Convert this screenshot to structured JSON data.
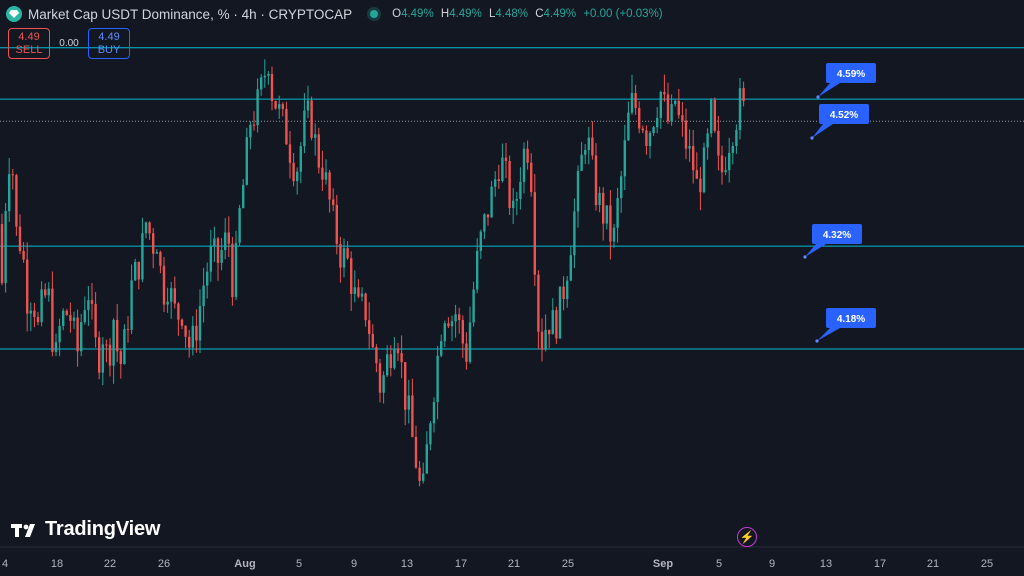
{
  "header": {
    "symbol_title": "Market Cap USDT Dominance, % · 4h · CRYPTOCAP",
    "ohlc": [
      {
        "k": "O",
        "v": "4.49%"
      },
      {
        "k": "H",
        "v": "4.49%"
      },
      {
        "k": "L",
        "v": "4.48%"
      },
      {
        "k": "C",
        "v": "4.49%"
      },
      {
        "k": "",
        "v": "+0.00 (+0.03%)"
      }
    ]
  },
  "trade": {
    "sell_price": "4.49",
    "sell_label": "SELL",
    "spread": "0.00",
    "buy_price": "4.49",
    "buy_label": "BUY"
  },
  "branding": {
    "name": "TradingView"
  },
  "colors": {
    "background": "#131722",
    "up": "#26a69a",
    "down": "#ef5350",
    "level_line": "#00bcd4",
    "label_bg": "#2962ff",
    "axis_text": "#b2b5be"
  },
  "chart_data": {
    "type": "candlestick",
    "title": "Market Cap USDT Dominance, % · 4h · CRYPTOCAP",
    "unit": "%",
    "ylim": [
      3.92,
      4.655
    ],
    "x_ticks": [
      "4",
      "18",
      "22",
      "26",
      "Aug",
      "5",
      "9",
      "13",
      "17",
      "21",
      "25",
      "Sep",
      "5",
      "9",
      "13",
      "17",
      "21",
      "25"
    ],
    "bold_ticks": [
      "Aug",
      "Sep"
    ],
    "levels": [
      {
        "label": "4.59%",
        "value": 4.59
      },
      {
        "label": "4.52%",
        "value": 4.52
      },
      {
        "label": "4.32%",
        "value": 4.32
      },
      {
        "label": "4.18%",
        "value": 4.18
      }
    ],
    "last_price": 4.49,
    "price_path": [
      [
        0,
        4.35
      ],
      [
        2,
        4.27
      ],
      [
        5,
        4.37
      ],
      [
        9,
        4.44
      ],
      [
        13,
        4.42
      ],
      [
        16,
        4.34
      ],
      [
        22,
        4.32
      ],
      [
        28,
        4.24
      ],
      [
        33,
        4.26
      ],
      [
        37,
        4.2
      ],
      [
        42,
        4.24
      ],
      [
        48,
        4.26
      ],
      [
        55,
        4.16
      ],
      [
        61,
        4.22
      ],
      [
        66,
        4.23
      ],
      [
        72,
        4.22
      ],
      [
        77,
        4.17
      ],
      [
        83,
        4.24
      ],
      [
        89,
        4.26
      ],
      [
        94,
        4.19
      ],
      [
        99,
        4.17
      ],
      [
        104,
        4.21
      ],
      [
        108,
        4.15
      ],
      [
        113,
        4.23
      ],
      [
        117,
        4.18
      ],
      [
        121,
        4.16
      ],
      [
        126,
        4.2
      ],
      [
        132,
        4.27
      ],
      [
        140,
        4.3
      ],
      [
        148,
        4.37
      ],
      [
        151,
        4.31
      ],
      [
        156,
        4.34
      ],
      [
        160,
        4.29
      ],
      [
        164,
        4.26
      ],
      [
        168,
        4.27
      ],
      [
        173,
        4.24
      ],
      [
        177,
        4.22
      ],
      [
        181,
        4.24
      ],
      [
        185,
        4.21
      ],
      [
        190,
        4.18
      ],
      [
        195,
        4.2
      ],
      [
        199,
        4.23
      ],
      [
        205,
        4.28
      ],
      [
        212,
        4.31
      ],
      [
        218,
        4.3
      ],
      [
        224,
        4.32
      ],
      [
        228,
        4.34
      ],
      [
        232,
        4.27
      ],
      [
        236,
        4.3
      ],
      [
        240,
        4.37
      ],
      [
        245,
        4.42
      ],
      [
        250,
        4.49
      ],
      [
        255,
        4.5
      ],
      [
        259,
        4.52
      ],
      [
        264,
        4.55
      ],
      [
        268,
        4.58
      ],
      [
        272,
        4.53
      ],
      [
        277,
        4.51
      ],
      [
        282,
        4.49
      ],
      [
        287,
        4.47
      ],
      [
        292,
        4.44
      ],
      [
        296,
        4.42
      ],
      [
        300,
        4.45
      ],
      [
        305,
        4.49
      ],
      [
        310,
        4.5
      ],
      [
        314,
        4.47
      ],
      [
        318,
        4.44
      ],
      [
        322,
        4.43
      ],
      [
        327,
        4.4
      ],
      [
        332,
        4.36
      ],
      [
        337,
        4.33
      ],
      [
        342,
        4.3
      ],
      [
        346,
        4.31
      ],
      [
        350,
        4.28
      ],
      [
        355,
        4.25
      ],
      [
        359,
        4.23
      ],
      [
        364,
        4.24
      ],
      [
        368,
        4.22
      ],
      [
        372,
        4.18
      ],
      [
        377,
        4.16
      ],
      [
        381,
        4.12
      ],
      [
        386,
        4.16
      ],
      [
        391,
        4.18
      ],
      [
        395,
        4.21
      ],
      [
        399,
        4.19
      ],
      [
        404,
        4.12
      ],
      [
        408,
        4.1
      ],
      [
        412,
        4.06
      ],
      [
        417,
        4.02
      ],
      [
        422,
        3.97
      ],
      [
        426,
        4.03
      ],
      [
        431,
        4.1
      ],
      [
        436,
        4.15
      ],
      [
        441,
        4.21
      ],
      [
        446,
        4.24
      ],
      [
        451,
        4.22
      ],
      [
        456,
        4.23
      ],
      [
        461,
        4.2
      ],
      [
        466,
        4.17
      ],
      [
        471,
        4.23
      ],
      [
        476,
        4.29
      ],
      [
        481,
        4.33
      ],
      [
        486,
        4.36
      ],
      [
        490,
        4.38
      ],
      [
        495,
        4.41
      ],
      [
        500,
        4.44
      ],
      [
        505,
        4.42
      ],
      [
        509,
        4.39
      ],
      [
        513,
        4.36
      ],
      [
        517,
        4.39
      ],
      [
        522,
        4.44
      ],
      [
        527,
        4.46
      ],
      [
        531,
        4.42
      ],
      [
        536,
        4.27
      ],
      [
        540,
        4.18
      ],
      [
        545,
        4.21
      ],
      [
        550,
        4.22
      ],
      [
        555,
        4.21
      ],
      [
        560,
        4.24
      ],
      [
        565,
        4.27
      ],
      [
        570,
        4.32
      ],
      [
        575,
        4.37
      ],
      [
        580,
        4.42
      ],
      [
        585,
        4.47
      ],
      [
        590,
        4.45
      ],
      [
        594,
        4.4
      ],
      [
        599,
        4.38
      ],
      [
        604,
        4.36
      ],
      [
        608,
        4.35
      ],
      [
        613,
        4.32
      ],
      [
        618,
        4.38
      ],
      [
        623,
        4.43
      ],
      [
        628,
        4.49
      ],
      [
        633,
        4.52
      ],
      [
        638,
        4.5
      ],
      [
        643,
        4.49
      ],
      [
        647,
        4.47
      ],
      [
        652,
        4.49
      ],
      [
        656,
        4.51
      ],
      [
        661,
        4.53
      ],
      [
        666,
        4.5
      ],
      [
        670,
        4.48
      ],
      [
        675,
        4.52
      ],
      [
        679,
        4.49
      ],
      [
        684,
        4.47
      ],
      [
        688,
        4.45
      ],
      [
        693,
        4.43
      ],
      [
        697,
        4.4
      ],
      [
        702,
        4.42
      ],
      [
        706,
        4.44
      ],
      [
        711,
        4.5
      ],
      [
        716,
        4.45
      ],
      [
        720,
        4.41
      ],
      [
        725,
        4.44
      ],
      [
        730,
        4.47
      ],
      [
        735,
        4.49
      ],
      [
        741,
        4.52
      ],
      [
        746,
        4.49
      ]
    ]
  }
}
